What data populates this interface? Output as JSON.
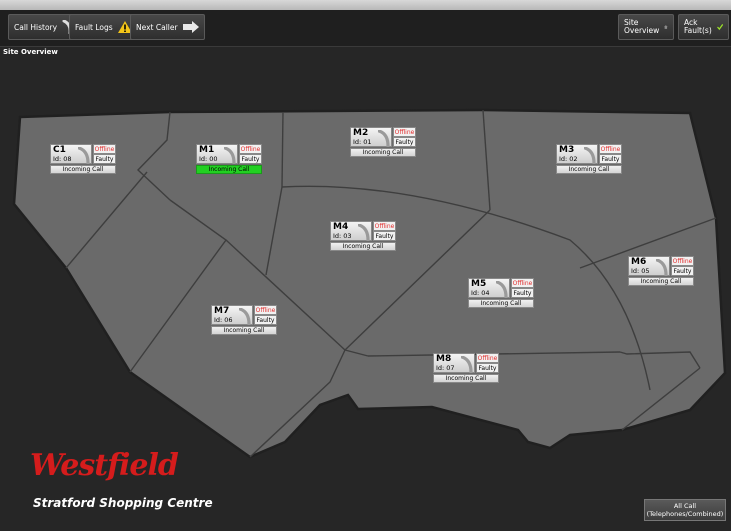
{
  "toolbar": {
    "call_history": "Call History",
    "fault_logs": "Fault Logs",
    "next_caller": "Next Caller",
    "site_overview_line1": "Site",
    "site_overview_line2": "Overview",
    "ack_line1": "Ack",
    "ack_line2": "Fault(s)"
  },
  "section_label": "Site Overview",
  "zones": [
    {
      "code": "C1",
      "id": "Id: 08",
      "status": "Offline",
      "fault": "Faulty",
      "call": "Incoming Call",
      "active": false
    },
    {
      "code": "M1",
      "id": "Id: 00",
      "status": "Offline",
      "fault": "Faulty",
      "call": "Incoming Call",
      "active": true
    },
    {
      "code": "M2",
      "id": "Id: 01",
      "status": "Offline",
      "fault": "Faulty",
      "call": "Incoming Call",
      "active": false
    },
    {
      "code": "M3",
      "id": "Id: 02",
      "status": "Offline",
      "fault": "Faulty",
      "call": "Incoming Call",
      "active": false
    },
    {
      "code": "M4",
      "id": "Id: 03",
      "status": "Offline",
      "fault": "Faulty",
      "call": "Incoming Call",
      "active": false
    },
    {
      "code": "M5",
      "id": "Id: 04",
      "status": "Offline",
      "fault": "Faulty",
      "call": "Incoming Call",
      "active": false
    },
    {
      "code": "M6",
      "id": "Id: 05",
      "status": "Offline",
      "fault": "Faulty",
      "call": "Incoming Call",
      "active": false
    },
    {
      "code": "M7",
      "id": "Id: 06",
      "status": "Offline",
      "fault": "Faulty",
      "call": "Incoming Call",
      "active": false
    },
    {
      "code": "M8",
      "id": "Id: 07",
      "status": "Offline",
      "fault": "Faulty",
      "call": "Incoming Call",
      "active": false
    }
  ],
  "brand": {
    "logo": "Westfield",
    "subtitle": "Stratford Shopping Centre"
  },
  "all_call": {
    "line1": "All Call",
    "line2": "(Telephones/Combined)"
  },
  "colors": {
    "offline": "#e23030",
    "active_call": "#22d022",
    "logo": "#d51c1c"
  }
}
